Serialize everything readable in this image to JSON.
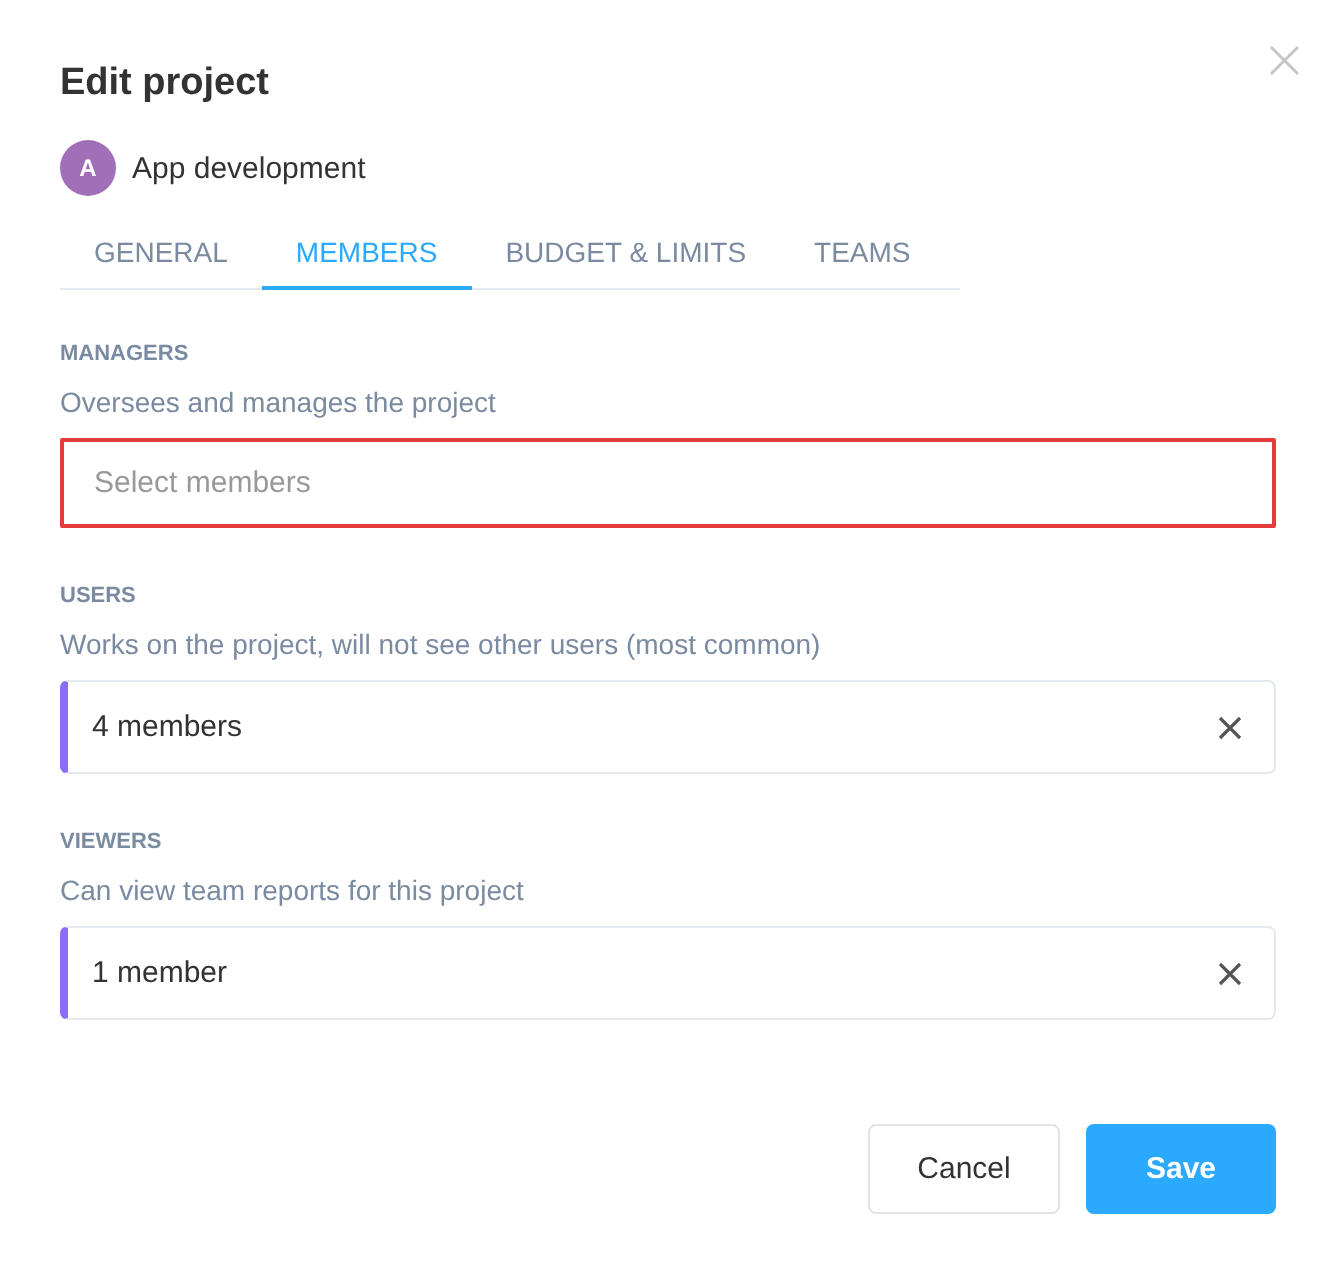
{
  "dialog": {
    "title": "Edit project",
    "close_icon": "×"
  },
  "project": {
    "initial": "A",
    "name": "App development",
    "color": "#a06fb8"
  },
  "tabs": [
    {
      "label": "GENERAL",
      "selected": false
    },
    {
      "label": "MEMBERS",
      "selected": true
    },
    {
      "label": "BUDGET & LIMITS",
      "selected": false
    },
    {
      "label": "TEAMS",
      "selected": false
    }
  ],
  "sections": [
    {
      "label": "MANAGERS",
      "description": "Oversees and manages the project",
      "placeholder": "Select members",
      "invalid": true
    },
    {
      "label": "USERS",
      "description": "Works on the project, will not see other users (most common)",
      "value": "4 members",
      "invalid": false
    },
    {
      "label": "VIEWERS",
      "description": "Can view team reports for this project",
      "value": "1 member",
      "invalid": false
    }
  ],
  "buttons": [
    {
      "label": "Cancel",
      "kind": "secondary"
    },
    {
      "label": "Save",
      "kind": "primary"
    }
  ]
}
